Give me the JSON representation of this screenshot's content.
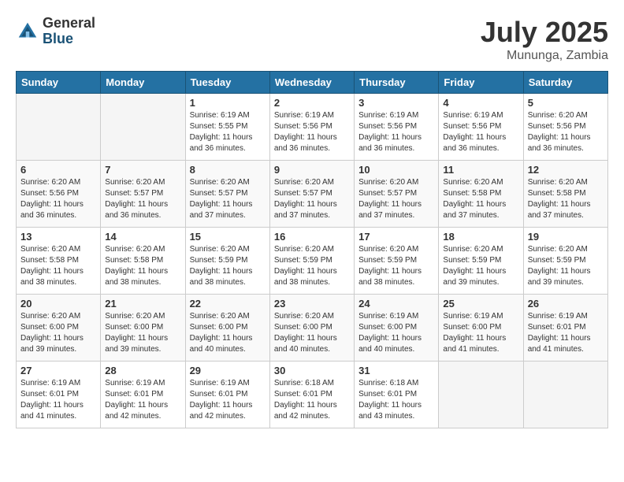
{
  "header": {
    "logo_general": "General",
    "logo_blue": "Blue",
    "month": "July 2025",
    "location": "Mununga, Zambia"
  },
  "days_of_week": [
    "Sunday",
    "Monday",
    "Tuesday",
    "Wednesday",
    "Thursday",
    "Friday",
    "Saturday"
  ],
  "weeks": [
    [
      {
        "num": "",
        "detail": ""
      },
      {
        "num": "",
        "detail": ""
      },
      {
        "num": "1",
        "detail": "Sunrise: 6:19 AM\nSunset: 5:55 PM\nDaylight: 11 hours and 36 minutes."
      },
      {
        "num": "2",
        "detail": "Sunrise: 6:19 AM\nSunset: 5:56 PM\nDaylight: 11 hours and 36 minutes."
      },
      {
        "num": "3",
        "detail": "Sunrise: 6:19 AM\nSunset: 5:56 PM\nDaylight: 11 hours and 36 minutes."
      },
      {
        "num": "4",
        "detail": "Sunrise: 6:19 AM\nSunset: 5:56 PM\nDaylight: 11 hours and 36 minutes."
      },
      {
        "num": "5",
        "detail": "Sunrise: 6:20 AM\nSunset: 5:56 PM\nDaylight: 11 hours and 36 minutes."
      }
    ],
    [
      {
        "num": "6",
        "detail": "Sunrise: 6:20 AM\nSunset: 5:56 PM\nDaylight: 11 hours and 36 minutes."
      },
      {
        "num": "7",
        "detail": "Sunrise: 6:20 AM\nSunset: 5:57 PM\nDaylight: 11 hours and 36 minutes."
      },
      {
        "num": "8",
        "detail": "Sunrise: 6:20 AM\nSunset: 5:57 PM\nDaylight: 11 hours and 37 minutes."
      },
      {
        "num": "9",
        "detail": "Sunrise: 6:20 AM\nSunset: 5:57 PM\nDaylight: 11 hours and 37 minutes."
      },
      {
        "num": "10",
        "detail": "Sunrise: 6:20 AM\nSunset: 5:57 PM\nDaylight: 11 hours and 37 minutes."
      },
      {
        "num": "11",
        "detail": "Sunrise: 6:20 AM\nSunset: 5:58 PM\nDaylight: 11 hours and 37 minutes."
      },
      {
        "num": "12",
        "detail": "Sunrise: 6:20 AM\nSunset: 5:58 PM\nDaylight: 11 hours and 37 minutes."
      }
    ],
    [
      {
        "num": "13",
        "detail": "Sunrise: 6:20 AM\nSunset: 5:58 PM\nDaylight: 11 hours and 38 minutes."
      },
      {
        "num": "14",
        "detail": "Sunrise: 6:20 AM\nSunset: 5:58 PM\nDaylight: 11 hours and 38 minutes."
      },
      {
        "num": "15",
        "detail": "Sunrise: 6:20 AM\nSunset: 5:59 PM\nDaylight: 11 hours and 38 minutes."
      },
      {
        "num": "16",
        "detail": "Sunrise: 6:20 AM\nSunset: 5:59 PM\nDaylight: 11 hours and 38 minutes."
      },
      {
        "num": "17",
        "detail": "Sunrise: 6:20 AM\nSunset: 5:59 PM\nDaylight: 11 hours and 38 minutes."
      },
      {
        "num": "18",
        "detail": "Sunrise: 6:20 AM\nSunset: 5:59 PM\nDaylight: 11 hours and 39 minutes."
      },
      {
        "num": "19",
        "detail": "Sunrise: 6:20 AM\nSunset: 5:59 PM\nDaylight: 11 hours and 39 minutes."
      }
    ],
    [
      {
        "num": "20",
        "detail": "Sunrise: 6:20 AM\nSunset: 6:00 PM\nDaylight: 11 hours and 39 minutes."
      },
      {
        "num": "21",
        "detail": "Sunrise: 6:20 AM\nSunset: 6:00 PM\nDaylight: 11 hours and 39 minutes."
      },
      {
        "num": "22",
        "detail": "Sunrise: 6:20 AM\nSunset: 6:00 PM\nDaylight: 11 hours and 40 minutes."
      },
      {
        "num": "23",
        "detail": "Sunrise: 6:20 AM\nSunset: 6:00 PM\nDaylight: 11 hours and 40 minutes."
      },
      {
        "num": "24",
        "detail": "Sunrise: 6:19 AM\nSunset: 6:00 PM\nDaylight: 11 hours and 40 minutes."
      },
      {
        "num": "25",
        "detail": "Sunrise: 6:19 AM\nSunset: 6:00 PM\nDaylight: 11 hours and 41 minutes."
      },
      {
        "num": "26",
        "detail": "Sunrise: 6:19 AM\nSunset: 6:01 PM\nDaylight: 11 hours and 41 minutes."
      }
    ],
    [
      {
        "num": "27",
        "detail": "Sunrise: 6:19 AM\nSunset: 6:01 PM\nDaylight: 11 hours and 41 minutes."
      },
      {
        "num": "28",
        "detail": "Sunrise: 6:19 AM\nSunset: 6:01 PM\nDaylight: 11 hours and 42 minutes."
      },
      {
        "num": "29",
        "detail": "Sunrise: 6:19 AM\nSunset: 6:01 PM\nDaylight: 11 hours and 42 minutes."
      },
      {
        "num": "30",
        "detail": "Sunrise: 6:18 AM\nSunset: 6:01 PM\nDaylight: 11 hours and 42 minutes."
      },
      {
        "num": "31",
        "detail": "Sunrise: 6:18 AM\nSunset: 6:01 PM\nDaylight: 11 hours and 43 minutes."
      },
      {
        "num": "",
        "detail": ""
      },
      {
        "num": "",
        "detail": ""
      }
    ]
  ]
}
